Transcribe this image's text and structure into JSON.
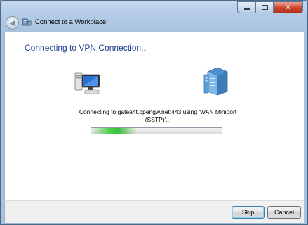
{
  "window": {
    "title": "Connect to a Workplace",
    "controls": {
      "minimize": "",
      "maximize": "",
      "close": "✕"
    }
  },
  "main": {
    "heading": "Connecting to VPN Connection...",
    "status_text": "Connecting to gatea4t.opengw.net:443 using 'WAN Miniport (SSTP)'...",
    "progress": 0.35
  },
  "buttons": {
    "skip": "Skip",
    "cancel": "Cancel"
  },
  "icons": {
    "back": "back-arrow-icon",
    "app": "network-workplace-icon",
    "local": "computer-icon",
    "remote": "server-icon"
  },
  "colors": {
    "heading": "#1d3f8f",
    "progress": "#4ccf4c"
  }
}
